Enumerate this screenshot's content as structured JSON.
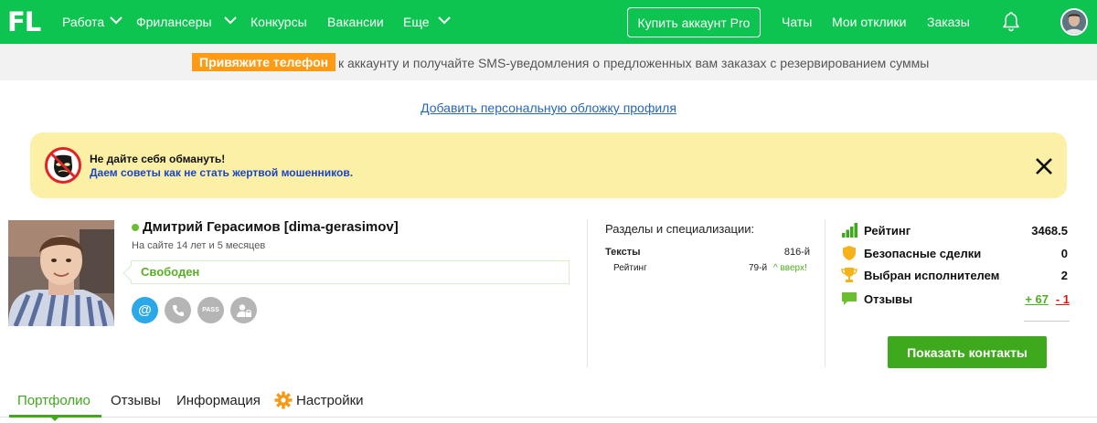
{
  "header": {
    "logo": "FL",
    "nav": [
      {
        "label": "Работа",
        "has_menu": true
      },
      {
        "label": "Фрилансеры",
        "has_menu": true
      },
      {
        "label": "Конкурсы",
        "has_menu": false
      },
      {
        "label": "Вакансии",
        "has_menu": false
      },
      {
        "label": "Еще",
        "has_menu": true
      }
    ],
    "pro_button": "Купить аккаунт Pro",
    "links": [
      "Чаты",
      "Мои отклики",
      "Заказы"
    ],
    "bell_icon": "bell-icon",
    "avatar_icon": "avatar"
  },
  "sms_banner": {
    "badge": "Привяжите телефон",
    "text": "к аккаунту и получайте SMS-уведомления о предложенных вам заказах с резервированием суммы"
  },
  "cover_link": "Добавить персональную обложку профиля",
  "warning": {
    "icon": "no-fraud-icon",
    "title": "Не дайте себя обмануть!",
    "link": "Даем советы как не стать жертвой мошенников.",
    "close_icon": "close-icon"
  },
  "profile": {
    "name": "Дмитрий Герасимов [dima-gerasimov]",
    "since": "На сайте 14 лет и 5 месяцев",
    "status": "Свободен",
    "contact_icons": [
      "email-icon",
      "phone-icon",
      "pass-icon",
      "user-lock-icon"
    ],
    "pass_label": "PASS",
    "email_symbol": "@"
  },
  "specs": {
    "title": "Разделы и специализации:",
    "category": "Тексты",
    "category_pos": "816-й",
    "sub_name": "Рейтинг",
    "sub_pos": "79-й",
    "sub_trend": "^ вверх!"
  },
  "stats": {
    "rating_label": "Рейтинг",
    "rating_value": "3468.5",
    "safe_deals_label": "Безопасные сделки",
    "safe_deals_value": "0",
    "chosen_label": "Выбран исполнителем",
    "chosen_value": "2",
    "reviews_label": "Отзывы",
    "reviews_pos": "+ 67",
    "reviews_neg": "- 1",
    "show_contacts": "Показать контакты"
  },
  "tabs": [
    {
      "label": "Портфолио",
      "active": true
    },
    {
      "label": "Отзывы",
      "active": false
    },
    {
      "label": "Информация",
      "active": false
    },
    {
      "label": "Настройки",
      "active": false
    }
  ],
  "colors": {
    "header_green": "#0cc44f",
    "badge_orange": "#ff9a14",
    "warning_yellow": "#fbf0a6",
    "button_green": "#3fa91e",
    "link_blue": "#2667b6"
  }
}
